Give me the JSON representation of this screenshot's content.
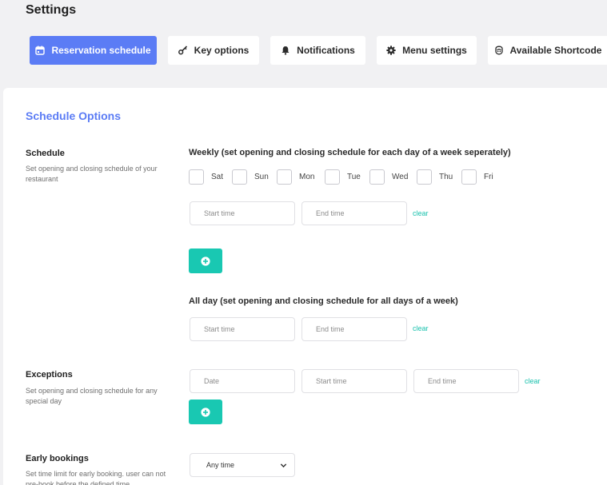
{
  "page": {
    "title": "Settings"
  },
  "tabs": [
    {
      "label": "Reservation schedule",
      "icon": "calendar-icon",
      "active": true
    },
    {
      "label": "Key options",
      "icon": "key-icon",
      "active": false
    },
    {
      "label": "Notifications",
      "icon": "bell-icon",
      "active": false
    },
    {
      "label": "Menu settings",
      "icon": "gear-icon",
      "active": false
    },
    {
      "label": "Available Shortcode",
      "icon": "code-icon",
      "active": false
    }
  ],
  "section": {
    "title": "Schedule Options"
  },
  "schedule": {
    "label": "Schedule",
    "description": "Set opening and closing schedule of your restaurant",
    "weekly_title": "Weekly (set opening and closing schedule for each day of a week seperately)",
    "days": [
      "Sat",
      "Sun",
      "Mon",
      "Tue",
      "Wed",
      "Thu",
      "Fri"
    ],
    "start_placeholder": "Start time",
    "end_placeholder": "End time",
    "clear_label": "clear",
    "all_day_title": "All day (set opening and closing schedule for all days of a week)"
  },
  "exceptions": {
    "label": "Exceptions",
    "description": "Set opening and closing schedule for any special day",
    "date_placeholder": "Date",
    "start_placeholder": "Start time",
    "end_placeholder": "End time",
    "clear_label": "clear"
  },
  "early_bookings": {
    "label": "Early bookings",
    "description": "Set time limit for early booking. user can not pre-book before the defined time",
    "selected": "Any time"
  },
  "colors": {
    "accent": "#5b7cf5",
    "teal": "#19c8b2",
    "clear_link": "#19c1ad"
  }
}
